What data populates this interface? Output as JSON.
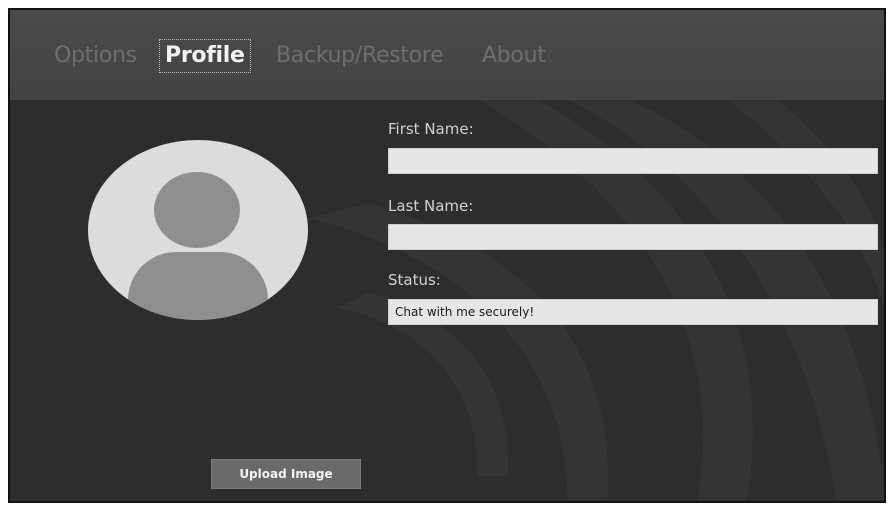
{
  "tabs": [
    {
      "label": "Options",
      "active": false
    },
    {
      "label": "Profile",
      "active": true
    },
    {
      "label": "Backup/Restore",
      "active": false
    },
    {
      "label": "About",
      "active": false
    }
  ],
  "profile": {
    "avatar_icon": "user-avatar-icon",
    "first_name": {
      "label": "First Name:",
      "value": ""
    },
    "last_name": {
      "label": "Last Name:",
      "value": ""
    },
    "status": {
      "label": "Status:",
      "value": "Chat with me securely!"
    },
    "upload_label": "Upload Image"
  },
  "colors": {
    "window_bg": "#2d2d2d",
    "tabbar_bg": "#4a4a4a",
    "tab_inactive": "#6e6e6e",
    "tab_active": "#f2f2f2",
    "field_bg": "#e6e6e6",
    "avatar_bg": "#dcdcdc",
    "avatar_figure": "#8f8f8f",
    "button_bg": "#6a6a6a"
  }
}
